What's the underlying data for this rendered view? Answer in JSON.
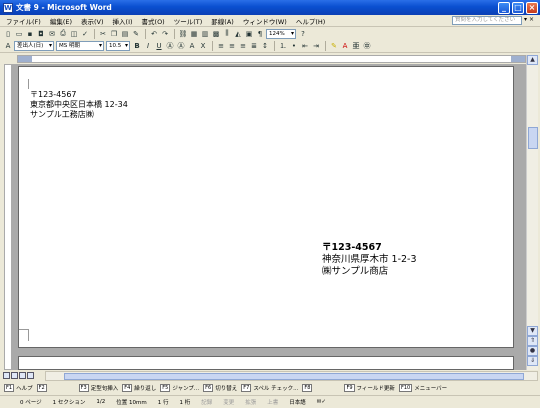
{
  "window": {
    "title": "文書 9 - Microsoft Word"
  },
  "menu": {
    "items": [
      "ファイル(F)",
      "編集(E)",
      "表示(V)",
      "挿入(I)",
      "書式(O)",
      "ツール(T)",
      "罫線(A)",
      "ウィンドウ(W)",
      "ヘルプ(H)"
    ],
    "ask_placeholder": "質問を入力してください"
  },
  "toolbar": {
    "zoom": "124%",
    "style": "差出人(日)",
    "font": "MS 明朝",
    "size": "10.5"
  },
  "document": {
    "sender": {
      "zip": "〒123-4567",
      "address": "東京都中央区日本橋 12-34",
      "name": "サンプル工務店㈱"
    },
    "recipient": {
      "zip": "〒123-4567",
      "address": "神奈川県厚木市 1-2-3",
      "name": "㈱サンプル商店"
    }
  },
  "function_keys": [
    {
      "num": "F1",
      "label": "ヘルプ"
    },
    {
      "num": "F2",
      "label": ""
    },
    {
      "num": "F3",
      "label": "定型句挿入"
    },
    {
      "num": "F4",
      "label": "繰り返し"
    },
    {
      "num": "F5",
      "label": "ジャンプ..."
    },
    {
      "num": "F6",
      "label": "切り替え"
    },
    {
      "num": "F7",
      "label": "スペル チェック..."
    },
    {
      "num": "F8",
      "label": ""
    },
    {
      "num": "F9",
      "label": "フィールド更新"
    },
    {
      "num": "F10",
      "label": "メニューバー"
    }
  ],
  "status": {
    "page": "0 ページ",
    "section": "1 セクション",
    "pages": "1/2",
    "position": "位置 10mm",
    "line": "1 行",
    "column": "1 桁",
    "rec": "記録",
    "trk": "変更",
    "ext": "拡張",
    "ovr": "上書",
    "lang": "日本語"
  },
  "colors": {
    "title_bar": "#0a4fd0",
    "ruler_margin": "#9fb0cf"
  }
}
